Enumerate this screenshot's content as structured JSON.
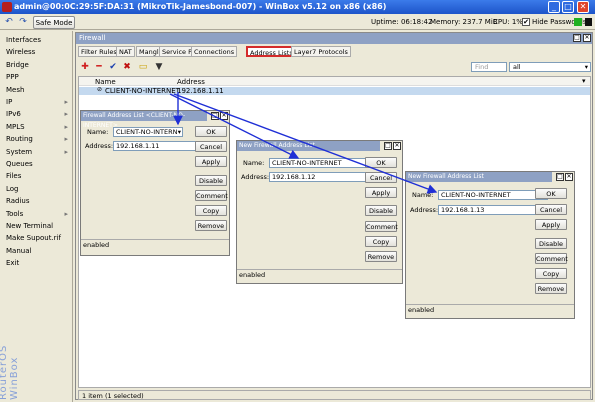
{
  "window": {
    "title": "admin@00:0C:29:5F:DA:31 (MikroTik-Jamesbond-007) - WinBox v5.12 on x86 (x86)"
  },
  "toolbar": {
    "safe_mode": "Safe Mode",
    "uptime": "Uptime: 06:18:42",
    "memory": "Memory: 237.7 MiB",
    "cpu": "CPU: 1%",
    "hide_passwords": "Hide Passwords"
  },
  "sidebar": {
    "items": [
      {
        "label": "Interfaces",
        "submenu": false
      },
      {
        "label": "Wireless",
        "submenu": false
      },
      {
        "label": "Bridge",
        "submenu": false
      },
      {
        "label": "PPP",
        "submenu": false
      },
      {
        "label": "Mesh",
        "submenu": false
      },
      {
        "label": "IP",
        "submenu": true
      },
      {
        "label": "IPv6",
        "submenu": true
      },
      {
        "label": "MPLS",
        "submenu": true
      },
      {
        "label": "Routing",
        "submenu": true
      },
      {
        "label": "System",
        "submenu": true
      },
      {
        "label": "Queues",
        "submenu": false
      },
      {
        "label": "Files",
        "submenu": false
      },
      {
        "label": "Log",
        "submenu": false
      },
      {
        "label": "Radius",
        "submenu": false
      },
      {
        "label": "Tools",
        "submenu": true
      },
      {
        "label": "New Terminal",
        "submenu": false
      },
      {
        "label": "Make Supout.rif",
        "submenu": false
      },
      {
        "label": "Manual",
        "submenu": false
      },
      {
        "label": "Exit",
        "submenu": false
      }
    ],
    "brand": "RouterOS WinBox"
  },
  "firewall": {
    "title": "Firewall",
    "tabs": [
      "Filter Rules",
      "NAT",
      "Mangle",
      "Service Ports",
      "Connections",
      "Address Lists",
      "Layer7 Protocols"
    ],
    "active_tab": "Address Lists",
    "find_placeholder": "Find",
    "filter_value": "all",
    "columns": [
      "Name",
      "Address"
    ],
    "rows": [
      {
        "name": "CLIENT-NO-INTERNET",
        "address": "192.168.1.11"
      }
    ],
    "status": "1 item (1 selected)"
  },
  "dialogs": [
    {
      "title": "Firewall Address List <CLIENT-NO-INTERNET>",
      "name": "CLIENT-NO-INTERN",
      "address": "192.168.1.11",
      "status": "enabled",
      "buttons": [
        "OK",
        "Cancel",
        "Apply",
        "Disable",
        "Comment",
        "Copy",
        "Remove"
      ]
    },
    {
      "title": "New Firewall Address List",
      "name": "CLIENT-NO-INTERNET",
      "address": "192.168.1.12",
      "status": "enabled",
      "buttons": [
        "OK",
        "Cancel",
        "Apply",
        "Disable",
        "Comment",
        "Copy",
        "Remove"
      ]
    },
    {
      "title": "New Firewall Address List",
      "name": "CLIENT-NO-INTERNET",
      "address": "192.168.1.13",
      "status": "enabled",
      "buttons": [
        "OK",
        "Cancel",
        "Apply",
        "Disable",
        "Comment",
        "Copy",
        "Remove"
      ]
    }
  ],
  "labels": {
    "name": "Name:",
    "address": "Address:"
  },
  "colors": {
    "annotation_arrow": "#1f2fd6",
    "tab_highlight": "#d42b2b",
    "title_blue": "#1d54c9"
  }
}
